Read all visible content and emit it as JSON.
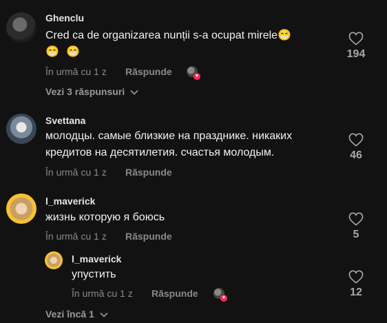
{
  "comments": [
    {
      "username": "Ghenclu",
      "text_line1": "Cred ca de organizarea nunții s-a ocupat mirele",
      "emojis_line1": "😁",
      "emojis_line2": [
        "😁",
        "😁"
      ],
      "time": "În urmă cu 1 z",
      "reply_label": "Răspunde",
      "likes": "194",
      "view_replies": "Vezi 3 răspunsuri"
    },
    {
      "username": "Svettana",
      "text_line1": "молодцы. самые близкие на празднике. никаких",
      "text_line2": "кредитов на десятилетия. счастья молодым.",
      "time": "În urmă cu 1 z",
      "reply_label": "Răspunde",
      "likes": "46"
    },
    {
      "username": "l_maverick",
      "text_line1": "жизнь которую я боюсь",
      "time": "În urmă cu 1 z",
      "reply_label": "Răspunde",
      "likes": "5",
      "reply": {
        "username": "l_maverick",
        "text_line1": "упустить",
        "time": "În urmă cu 1 z",
        "reply_label": "Răspunde",
        "likes": "12"
      },
      "view_more": "Vezi încă 1"
    }
  ],
  "colors": {
    "background": "#121212",
    "secondary_text": "#8a8a8a",
    "creator_heart": "#fe2c55"
  },
  "icons": {
    "like": "heart-outline-icon",
    "expand": "chevron-down-icon"
  }
}
